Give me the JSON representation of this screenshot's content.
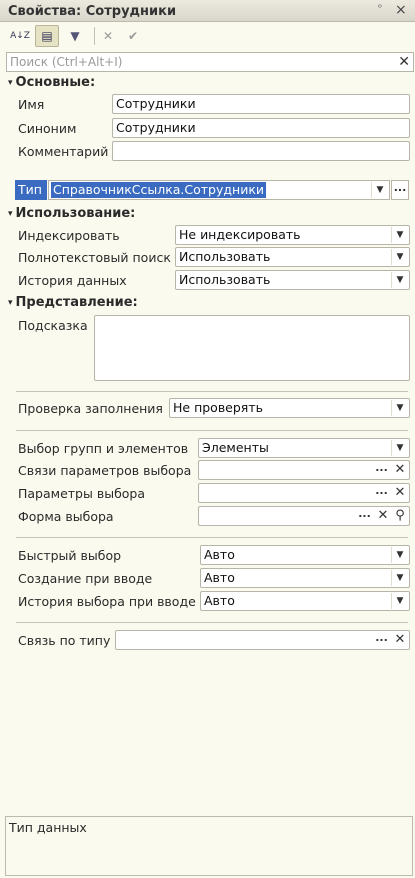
{
  "window": {
    "title": "Свойства: Сотрудники",
    "pin_glyph": "ᵒ",
    "close_glyph": "×"
  },
  "toolbar": {
    "sort_label": "A↓Z",
    "categories_label": "▤",
    "filter_label": "▼",
    "clear_label": "✕",
    "apply_label": "✔"
  },
  "search": {
    "placeholder": "Поиск (Ctrl+Alt+I)",
    "value": "",
    "clear": "✕"
  },
  "sections": {
    "main": "Основные:",
    "usage": "Использование:",
    "presentation": "Представление:"
  },
  "main": {
    "name_label": "Имя",
    "name_value": "Сотрудники",
    "synonym_label": "Синоним",
    "synonym_value": "Сотрудники",
    "comment_label": "Комментарий",
    "comment_value": "",
    "type_label": "Тип",
    "type_value": "СправочникСсылка.Сотрудники"
  },
  "usage": {
    "index_label": "Индексировать",
    "index_value": "Не индексировать",
    "fulltext_label": "Полнотекстовый поиск",
    "fulltext_value": "Использовать",
    "history_label": "История данных",
    "history_value": "Использовать"
  },
  "presentation": {
    "hint_label": "Подсказка",
    "hint_value": ""
  },
  "fill_check": {
    "label": "Проверка заполнения",
    "value": "Не проверять"
  },
  "choice": {
    "groups_label": "Выбор групп и элементов",
    "groups_value": "Элементы",
    "links_label": "Связи параметров выбора",
    "links_value": "",
    "params_label": "Параметры выбора",
    "params_value": "",
    "form_label": "Форма выбора",
    "form_value": ""
  },
  "quick": {
    "quick_label": "Быстрый выбор",
    "quick_value": "Авто",
    "create_label": "Создание при вводе",
    "create_value": "Авто",
    "history_label": "История выбора при вводе",
    "history_value": "Авто"
  },
  "type_link": {
    "label": "Связь по типу",
    "value": ""
  },
  "description": {
    "text": "Тип данных"
  },
  "glyphs": {
    "dropdown": "▼",
    "dots": "...",
    "clear": "✕",
    "search": "⚲",
    "triangle": "▾"
  }
}
